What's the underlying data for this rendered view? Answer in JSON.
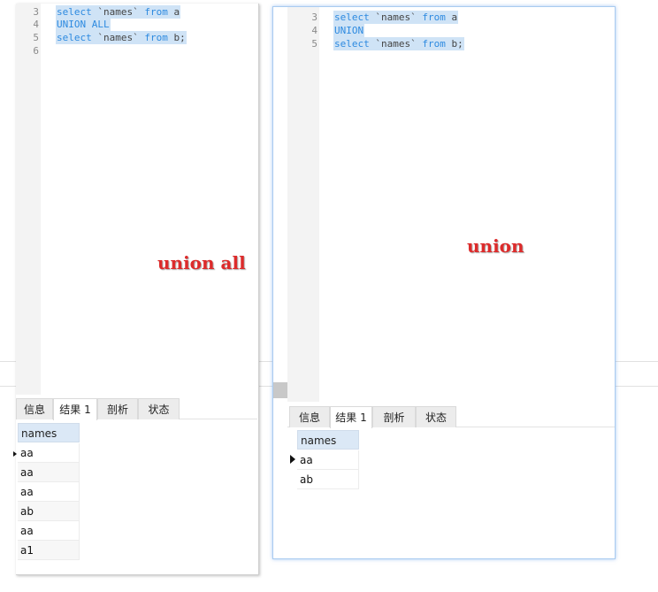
{
  "left": {
    "line_numbers": [
      "3",
      "4",
      "5",
      "6"
    ],
    "sql": {
      "l1_kw": "select",
      "l1_mid": " `names` ",
      "l1_kw2": "from",
      "l1_end": " a",
      "l2": "UNION ALL",
      "l3_kw": "select",
      "l3_mid": " `names` ",
      "l3_kw2": "from",
      "l3_end": " b;"
    },
    "annotation": "union all",
    "tabs": [
      "信息",
      "结果 1",
      "剖析",
      "状态"
    ],
    "active_tab": "结果 1",
    "column_header": "names",
    "rows": [
      "aa",
      "aa",
      "aa",
      "ab",
      "aa",
      "a1"
    ]
  },
  "right": {
    "line_numbers": [
      "3",
      "4",
      "5"
    ],
    "sql": {
      "l1_kw": "select",
      "l1_mid": " `names` ",
      "l1_kw2": "from",
      "l1_end": " a",
      "l2": "UNION",
      "l3_kw": "select",
      "l3_mid": " `names` ",
      "l3_kw2": "from",
      "l3_end": " b;"
    },
    "annotation": "union",
    "tabs": [
      "信息",
      "结果 1",
      "剖析",
      "状态"
    ],
    "active_tab": "结果 1",
    "column_header": "names",
    "rows": [
      "aa",
      "ab"
    ]
  },
  "colors": {
    "keyword": "#2d8ae0",
    "selection": "#cfe3f6",
    "annotation": "#dd2b2b",
    "header_cell": "#dbe8f6",
    "active_panel_border": "#a9cbf0"
  }
}
